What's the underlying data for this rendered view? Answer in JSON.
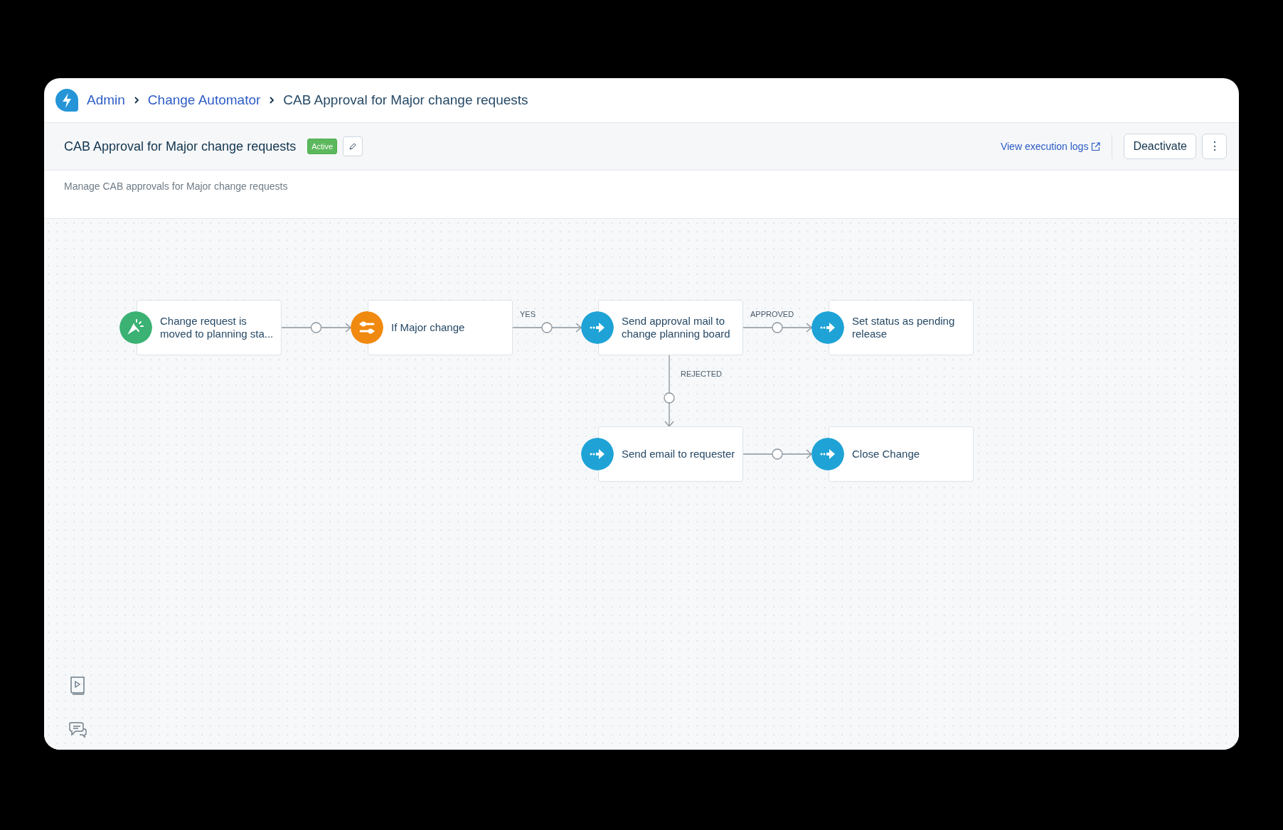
{
  "breadcrumb": [
    {
      "label": "Admin",
      "link": true
    },
    {
      "label": "Change Automator",
      "link": true
    },
    {
      "label": "CAB Approval for Major change requests",
      "link": false
    }
  ],
  "title": "CAB Approval for Major change requests",
  "status": "Active",
  "description": "Manage CAB approvals for Major change requests",
  "logs_link": "View execution logs",
  "buttons": [
    "Deactivate",
    "⋮"
  ],
  "nodes": [
    {
      "kind": "trigger",
      "text": "Change request is moved to planning sta..."
    },
    {
      "kind": "condition",
      "text": "If Major change"
    },
    {
      "kind": "action",
      "text": "Send approval mail to change planning board"
    },
    {
      "kind": "action",
      "text": "Set status as pending release"
    },
    {
      "kind": "action",
      "text": "Send email to requester"
    },
    {
      "kind": "action",
      "text": "Close Change"
    }
  ],
  "edges": [
    {
      "kind": "horizontal"
    },
    {
      "kind": "horizontal",
      "label": "YES"
    },
    {
      "kind": "horizontal",
      "label": "APPROVED"
    },
    {
      "kind": "vertical",
      "label": "REJECTED"
    },
    {
      "kind": "horizontal"
    }
  ]
}
